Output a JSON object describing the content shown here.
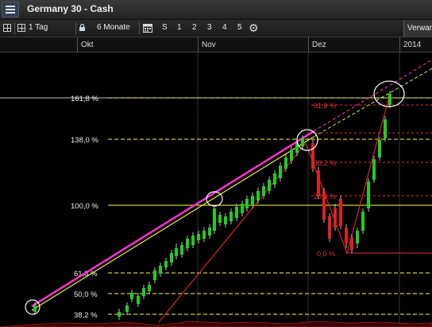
{
  "window": {
    "title": "Germany 30 - Cash"
  },
  "toolbar": {
    "interval": "1 Tag",
    "range": "6 Monate",
    "shortcuts": [
      "S",
      "1",
      "2",
      "3",
      "4",
      "5"
    ],
    "right_label": "Verwan"
  },
  "time_axis": {
    "labels": [
      "Okt",
      "Nov",
      "Dez",
      "2014"
    ]
  },
  "chart": {
    "fib_left": [
      "161,8 %",
      "138,0 %",
      "100,0 %",
      "61,8 %",
      "50,0 %",
      "38,2 %"
    ],
    "fib_right": [
      "61,8 %",
      "38,2 %",
      "23,6 %",
      "0,0 %"
    ]
  },
  "colors": {
    "background": "#000000",
    "up_candle": "#22cc22",
    "down_candle": "#dd2020",
    "fib_line": "#ffff40",
    "trend_magenta": "#ff33cc",
    "trend_yellow": "#f0f040"
  },
  "icons": [
    "menu-icon",
    "grid-icon",
    "lock-icon",
    "calendar-icon",
    "gear-icon"
  ]
}
